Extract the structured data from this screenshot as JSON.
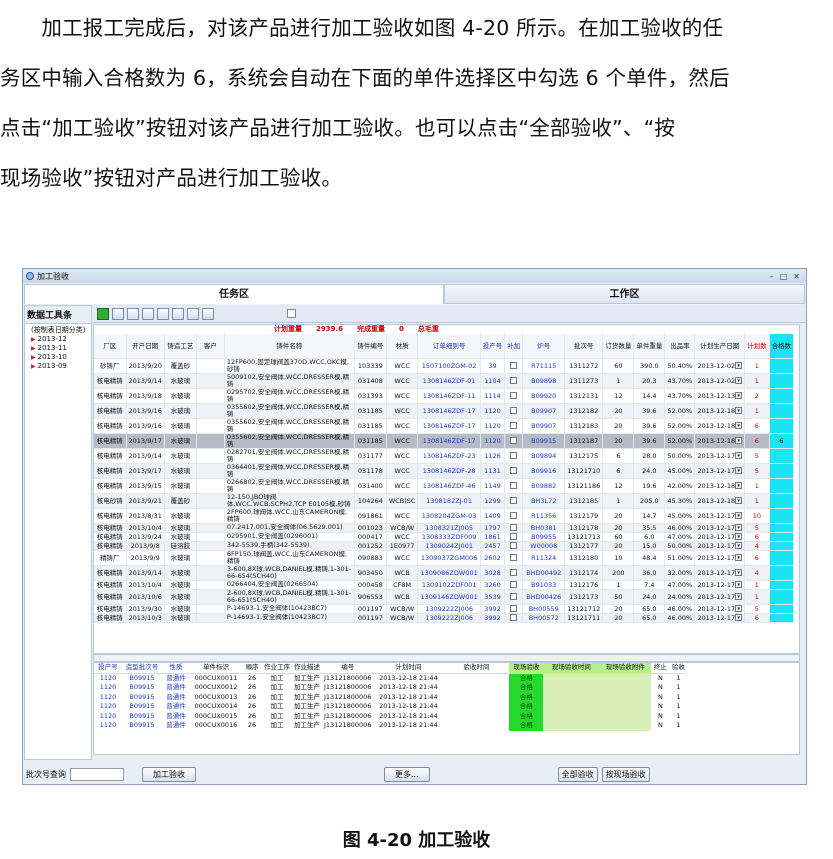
{
  "paragraph": {
    "lines": [
      "　　加工报工完成后，对该产品进行加工验收如图 4-20 所示。在加工验收的任",
      "务区中输入合格数为 6，系统会自动在下面的单件选择区中勾选 6 个单件，然后",
      "点击“加工验收”按钮对该产品进行加工验收。也可以点击“全部验收”、“按",
      "现场验收”按钮对产品进行加工验收。"
    ]
  },
  "caption": "图 4-20 加工验收",
  "window": {
    "title": "加工验收",
    "tab_task": "任务区",
    "tab_work": "工作区",
    "sidebar_title": "数据工具条",
    "tree": [
      "(按制表日期分类)",
      "2013-12",
      "2013-11",
      "2013-10",
      "2013-09"
    ]
  },
  "summary": {
    "plan_weight_label": "计划重量",
    "plan_weight": "2939.6",
    "done_weight_label": "完成重量",
    "done_weight": "0",
    "gross_label": "总毛重"
  },
  "grid_headers": [
    "厂区",
    "开户日期",
    "铸造工艺",
    "客户",
    "铸件名称",
    "铸件编号",
    "材质",
    "订单细则号",
    "投产号",
    "补加",
    "炉号",
    "批次号",
    "订货数量",
    "单件重量",
    "出品率",
    "计划生产日期",
    "计划数",
    "合格数"
  ],
  "rows": [
    {
      "c": [
        "砂铸厂",
        "2013/9/20",
        "覆盖砂",
        "",
        "12FP600,固定球阀盖370D,WCC,OKC模,砂铸",
        "103339",
        "WCC",
        "1507100ZGM-02",
        "39",
        "",
        "R71115",
        "1311272",
        "60",
        "390.0",
        "50.40%",
        "2013-12-02",
        "1",
        ""
      ]
    },
    {
      "c": [
        "核电精铸",
        "2013/9/14",
        "水玻璃",
        "",
        "5009102,安全阀体,WCC,DRESSER模,精铸",
        "031408",
        "WCC",
        "1308146ZDF-01",
        "1104",
        "",
        "B09898",
        "1311273",
        "1",
        "20.3",
        "43.70%",
        "2013-12-02",
        "1",
        ""
      ]
    },
    {
      "c": [
        "核电精铸",
        "2013/9/18",
        "水玻璃",
        "",
        "0295702,安全阀体,WCC,DRESSER模,精铸",
        "031393",
        "WCC",
        "1308146ZDF-11",
        "1114",
        "",
        "B09920",
        "1312131",
        "12",
        "14.4",
        "43.70%",
        "2013-12-13",
        "2",
        ""
      ]
    },
    {
      "c": [
        "核电精铸",
        "2013/9/16",
        "水玻璃",
        "",
        "0355602,安全阀体,WCC,DRESSER模,精铸",
        "031185",
        "WCC",
        "1308146ZDF-17",
        "1120",
        "",
        "B09907",
        "1312182",
        "20",
        "39.6",
        "52.00%",
        "2013-12-18",
        "1",
        ""
      ]
    },
    {
      "c": [
        "核电精铸",
        "2013/9/16",
        "水玻璃",
        "",
        "0355602,安全阀体,WCC,DRESSER模,精铸",
        "031185",
        "WCC",
        "1308146ZDF-17",
        "1120",
        "",
        "B09907",
        "1312183",
        "20",
        "39.6",
        "52.00%",
        "2013-12-18",
        "6",
        ""
      ]
    },
    {
      "c": [
        "核电精铸",
        "2013/9/17",
        "水玻璃",
        "",
        "0355602,安全阀体,WCC,DRESSER模,精铸",
        "031185",
        "WCC",
        "1308146ZDF-17",
        "1120",
        "",
        "B09915",
        "1312187",
        "20",
        "39.6",
        "52.00%",
        "2013-12-18",
        "6",
        "6"
      ],
      "sel": true
    },
    {
      "c": [
        "核电精铸",
        "2013/9/14",
        "水玻璃",
        "",
        "0282701,安全阀体,WCC,DRESSER模,精铸",
        "031177",
        "WCC",
        "1308146ZDF-23",
        "1126",
        "",
        "B09894",
        "1312175",
        "6",
        "28.0",
        "50.00%",
        "2013-12-17",
        "5",
        ""
      ]
    },
    {
      "c": [
        "核电精铸",
        "2013/9/17",
        "水玻璃",
        "",
        "0364401,安全阀体,WCC,DRESSER模,精铸",
        "031178",
        "WCC",
        "1308146ZDF-28",
        "1131",
        "",
        "B09916",
        "13121710",
        "6",
        "24.0",
        "45.00%",
        "2013-12-17",
        "5",
        ""
      ]
    },
    {
      "c": [
        "核电精铸",
        "2013/9/15",
        "水玻璃",
        "",
        "0266802,安全阀体,WCC,DRESSER模,精铸",
        "031400",
        "WCC",
        "1308146ZDF-46",
        "1149",
        "",
        "B09882",
        "13121186",
        "12",
        "19.6",
        "42.00%",
        "2013-12-18",
        "1",
        ""
      ]
    },
    {
      "c": [
        "核电砂铸",
        "2013/9/21",
        "覆盖砂",
        "",
        "12-150,JBO球阀体,WCC,WCB:SCPH2,TCP E0105模,砂铸",
        "104264",
        "WCB(SC",
        "1308182ZJ-01",
        "1299",
        "",
        "BH3L72",
        "1312185",
        "1",
        "205.0",
        "45.30%",
        "2013-12-18",
        "1",
        ""
      ]
    },
    {
      "c": [
        "核电精铸",
        "2013/8/31",
        "水玻璃",
        "",
        "2FP600,球阀体,WCC,山东CAMERON模,精铸",
        "091861",
        "WCC",
        "1308204ZGM-03",
        "1409",
        "",
        "R11356",
        "1312179",
        "20",
        "14.7",
        "45.00%",
        "2013-12-17",
        "10",
        ""
      ]
    },
    {
      "c": [
        "核电精铸",
        "2013/10/4",
        "水玻璃",
        "",
        "07.2417.001,安全阀体(06.5629.001)",
        "001023",
        "WCB/W",
        "1308321ZJ005",
        "1797",
        "",
        "BH0381",
        "1312178",
        "20",
        "35.5",
        "46.00%",
        "2013-12-17",
        "5",
        ""
      ]
    },
    {
      "c": [
        "核电精铸",
        "2013/9/24",
        "水玻璃",
        "",
        "0295901,安全阀盖(0296001)",
        "000417",
        "WCC",
        "1308333ZDF009",
        "1861",
        "",
        "B09955",
        "13121713",
        "60",
        "6.0",
        "47.00%",
        "2013-12-17",
        "6",
        ""
      ]
    },
    {
      "c": [
        "核电精铸",
        "2013/9/8",
        "硅溶胶",
        "",
        "342-5539,手柄(342-5539)",
        "001252",
        "1E0977",
        "1309024ZJ001",
        "2457",
        "",
        "W00008",
        "1312177",
        "20",
        "15.0",
        "50.00%",
        "2013-12-17",
        "4",
        ""
      ]
    },
    {
      "c": [
        "精铸厂",
        "2013/9/9",
        "水玻璃",
        "",
        "6FP150,球阀盖,WCC,山东CAMERON模,精铸",
        "090883",
        "WCC",
        "1309037ZGM006",
        "2602",
        "",
        "R11324",
        "1312180",
        "10",
        "48.4",
        "51.00%",
        "2013-12-17",
        "6",
        ""
      ]
    },
    {
      "c": [
        "核电精铸",
        "2013/9/14",
        "水玻璃",
        "",
        "3-600,8X球,WCB,DANIEL模,精铸,1-301-66-654(SCH40)",
        "903450",
        "WCB",
        "1309086ZDW001",
        "3028",
        "",
        "BHD00492",
        "1312174",
        "200",
        "36.0",
        "32.00%",
        "2013-12-17",
        "4",
        ""
      ]
    },
    {
      "c": [
        "核电精铸",
        "2013/10/4",
        "水玻璃",
        "",
        "0266404,安全阀盖(0266504)",
        "000458",
        "CF8M",
        "1309102ZDF001",
        "3260",
        "",
        "B91033",
        "1312176",
        "1",
        "7.4",
        "47.00%",
        "2013-12-17",
        "1",
        ""
      ]
    },
    {
      "c": [
        "核电精铸",
        "2013/10/6",
        "水玻璃",
        "",
        "2-600,8X球,WCB,DANIEL模,精铸,1-301-66-651(SCH40)",
        "906553",
        "WCB",
        "1309146ZDW001",
        "3539",
        "",
        "BHD00426",
        "1312173",
        "50",
        "24.0",
        "24.00%",
        "2013-12-17",
        "1",
        ""
      ]
    },
    {
      "c": [
        "核电精铸",
        "2013/9/30",
        "水玻璃",
        "",
        "P-14693-1,安全阀体(10423BC7)",
        "001197",
        "WCB/W",
        "1309222ZJ006",
        "3992",
        "",
        "BH00559",
        "13121712",
        "20",
        "65.0",
        "46.00%",
        "2013-12-17",
        "5",
        ""
      ]
    },
    {
      "c": [
        "核电精铸",
        "2013/10/3",
        "水玻璃",
        "",
        "P-14693-1,安全阀体(10423BC7)",
        "001197",
        "WCB/W",
        "1309222ZJ006",
        "3992",
        "",
        "BH00572",
        "13121711",
        "20",
        "65.0",
        "46.00%",
        "2013-12-17",
        "6",
        ""
      ]
    }
  ],
  "sub_headers": [
    "投产号",
    "造型批次号",
    "性质",
    "单件标识",
    "顺序",
    "作业工序",
    "作业描述",
    "编号",
    "计划时间",
    "验收时间",
    "现场验收",
    "现场验收时间",
    "现场验收附件",
    "终止",
    "验收"
  ],
  "sub_rows": [
    [
      "1120",
      "B09915",
      "普通件",
      "000CUX0011",
      "26",
      "加工",
      "加工生产",
      "J13121800006",
      "2013-12-18 21:44",
      "",
      "合格",
      "",
      "",
      "N",
      "1"
    ],
    [
      "1120",
      "B09915",
      "普通件",
      "000CUX0012",
      "26",
      "加工",
      "加工生产",
      "J13121800006",
      "2013-12-18 21:44",
      "",
      "合格",
      "",
      "",
      "N",
      "1"
    ],
    [
      "1120",
      "B09915",
      "普通件",
      "000CUX0013",
      "26",
      "加工",
      "加工生产",
      "J13121800006",
      "2013-12-18 21:44",
      "",
      "合格",
      "",
      "",
      "N",
      "1"
    ],
    [
      "1120",
      "B09915",
      "普通件",
      "000CUX0014",
      "26",
      "加工",
      "加工生产",
      "J13121800006",
      "2013-12-18 21:44",
      "",
      "合格",
      "",
      "",
      "N",
      "1"
    ],
    [
      "1120",
      "B09915",
      "普通件",
      "000CUX0015",
      "26",
      "加工",
      "加工生产",
      "J13121800006",
      "2013-12-18 21:44",
      "",
      "合格",
      "",
      "",
      "N",
      "1"
    ],
    [
      "1120",
      "B09915",
      "普通件",
      "000CUX0016",
      "26",
      "加工",
      "加工生产",
      "J13121800006",
      "2013-12-18 21:44",
      "",
      "合格",
      "",
      "",
      "N",
      "1"
    ]
  ],
  "bottom": {
    "batch_label": "批次号查询",
    "accept_btn": "加工验收",
    "more_btn": "更多...",
    "all_btn": "全部验收",
    "site_btn": "按现场验收"
  }
}
